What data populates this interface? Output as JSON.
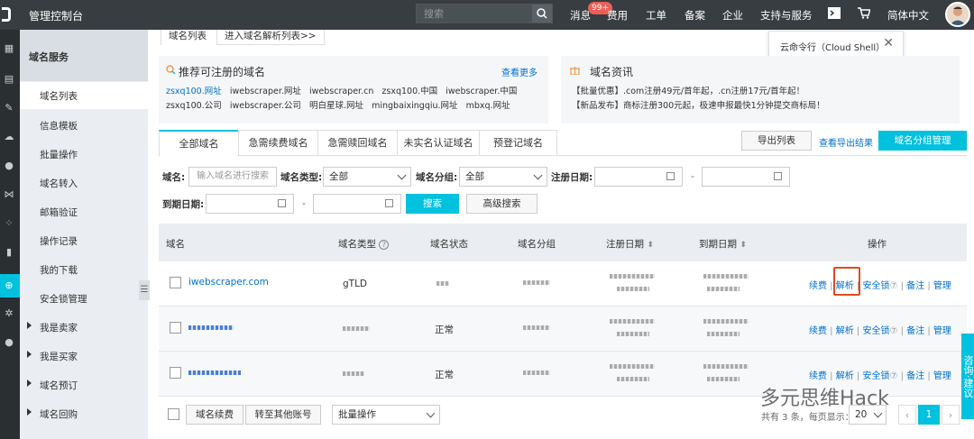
{
  "topbar": {
    "title": "管理控制台",
    "search_placeholder": "搜索",
    "items": [
      "消息",
      "费用",
      "工单",
      "备案",
      "企业",
      "支持与服务",
      "简体中文"
    ],
    "badge": "99+"
  },
  "tooltip": {
    "text": "云命令行（Cloud Shell）"
  },
  "top_tabs": [
    "域名列表",
    "进入域名解析列表>>"
  ],
  "sidebar": {
    "header": "域名服务",
    "items": [
      "域名列表",
      "信息模板",
      "批量操作",
      "域名转入",
      "邮箱验证",
      "操作记录",
      "我的下载",
      "安全锁管理"
    ],
    "groups": [
      "我是卖家",
      "我是买家",
      "域名预订",
      "域名回购"
    ]
  },
  "panels": {
    "left": {
      "title": "推荐可注册的域名",
      "more": "查看更多",
      "line1": [
        "zsxq100.网址",
        "iwebscraper.网址",
        "iwebscraper.cn",
        "zsxq100.中国",
        "iwebscraper.中国"
      ],
      "line2": [
        "zsxq100.公司",
        "iwebscraper.公司",
        "明白星球.网址",
        "mingbaixingqiu.网址",
        "mbxq.网址"
      ]
    },
    "right": {
      "title": "域名资讯",
      "line1": "【批量优惠】.com注册49元/首年起，.cn注册17元/首年起！",
      "line2": "【新品发布】商标注册300元起，极速申报最快1分钟提交商标局！"
    }
  },
  "tabs": [
    "全部域名",
    "急需续费域名",
    "急需赎回域名",
    "未实名认证域名",
    "预登记域名"
  ],
  "actions": {
    "export": "导出列表",
    "view_export": "查看导出结果",
    "group_manage": "域名分组管理"
  },
  "filters": {
    "domain_label": "域名:",
    "domain_placeholder": "输入域名进行搜索",
    "type_label": "域名类型:",
    "type_value": "全部",
    "group_label": "域名分组:",
    "group_value": "全部",
    "reg_label": "注册日期:",
    "exp_label": "到期日期:",
    "dash": "-",
    "search": "搜索",
    "advanced": "高级搜索"
  },
  "table": {
    "headers": [
      "域名",
      "域名类型",
      "域名状态",
      "域名分组",
      "注册日期",
      "到期日期",
      "操作"
    ],
    "rows": [
      {
        "domain": "iwebscraper.com",
        "type": "gTLD",
        "status": ""
      },
      {
        "domain": "",
        "type": "",
        "status": "正常"
      },
      {
        "domain": "",
        "type": "",
        "status": "正常"
      }
    ],
    "ops": [
      "续费",
      "解析",
      "安全锁",
      "备注",
      "管理"
    ]
  },
  "footer": {
    "renew": "域名续费",
    "transfer": "转至其他账号",
    "batch": "批量操作",
    "summary": "共有 3 条，每页显示：",
    "page_size": "20",
    "page": "1"
  },
  "float_button": "咨询·建议",
  "watermark": "多元思维Hack"
}
